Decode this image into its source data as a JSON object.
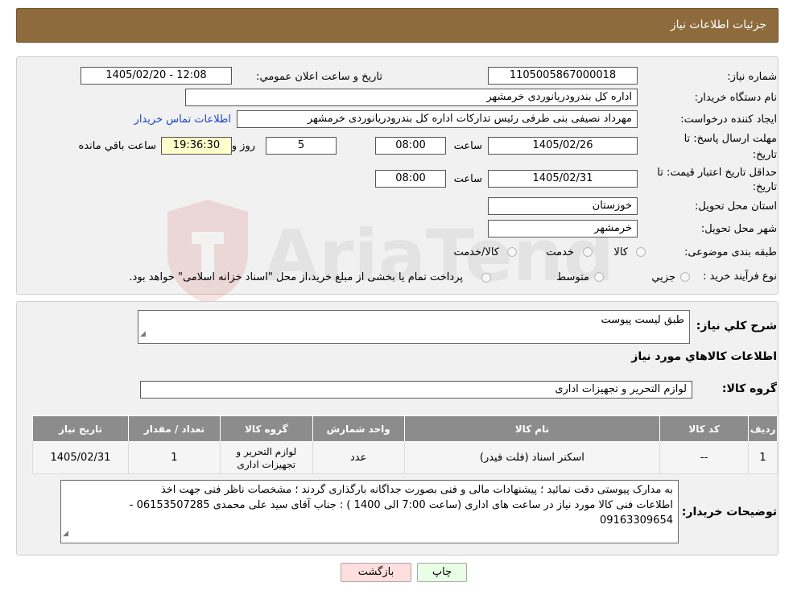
{
  "header": {
    "title": "جزئیات اطلاعات نیاز"
  },
  "fields": {
    "need_number_label": "شماره نیاز:",
    "need_number_value": "1105005867000018",
    "announce_label": "تاریخ و ساعت اعلان عمومي:",
    "announce_value": "1405/02/20 - 12:08",
    "buyer_label": "نام دستگاه خريدار:",
    "buyer_value": "اداره کل بندرودریانوردی خرمشهر",
    "creator_label": "ايجاد کننده درخواست:",
    "creator_value": "مهرداد  نصیفی بنی طرفی رئیس تدارکات اداره کل بندرودریانوردی خرمشهر",
    "contact_link": "اطلاعات تماس خريدار",
    "deadline_label_1": "مهلت ارسال پاسخ: تا",
    "deadline_label_2": "تاريخ:",
    "deadline_date": "1405/02/26",
    "time_label": "ساعت",
    "deadline_time": "08:00",
    "days_value": "5",
    "days_label": "روز و",
    "remaining_value": "19:36:30",
    "remaining_label": "ساعت باقي مانده",
    "validity_label_1": "حداقل تاريخ اعتبار قيمت: تا",
    "validity_label_2": "تاريخ:",
    "validity_date": "1405/02/31",
    "validity_time": "08:00",
    "province_label": "استان محل تحويل:",
    "province_value": "خوزستان",
    "city_label": "شهر محل تحويل:",
    "city_value": "خرمشهر",
    "category_label": "طبقه بندی موضوعی:",
    "category_options": [
      "کالا",
      "خدمت",
      "کالا/خدمت"
    ],
    "process_label": "نوع فرآيند خريد :",
    "process_options": [
      "جزيي",
      "متوسط"
    ],
    "process_note": "پرداخت تمام یا بخشی از مبلغ خرید،از محل \"اسناد خزانه اسلامی\" خواهد بود."
  },
  "summary": {
    "label": "شرح کلي نياز:",
    "value": "طبق لیست پیوست",
    "goods_info_title": "اطلاعات کالاهاي مورد نياز",
    "group_label": "گروه کالا:",
    "group_value": "لوازم التحریر و تجهیزات اداری"
  },
  "table": {
    "headers": [
      "رديف",
      "کد کالا",
      "نام کالا",
      "واحد شمارش",
      "گروه کالا",
      "تعداد / مقدار",
      "تاريخ نياز"
    ],
    "rows": [
      [
        "1",
        "--",
        "اسکنر اسناد (فلت فیدر)",
        "عدد",
        "لوازم التحریر و تجهیزات اداری",
        "1",
        "1405/02/31"
      ]
    ]
  },
  "notes": {
    "label": "توضيحات خريدار:",
    "line1": "به مدارک پیوستی دقت نمائید ؛ پیشنهادات مالی و فنی بصورت جداگانه بارگذاری گردند ؛ مشخصات ناظر فنی جهت اخذ",
    "line2": "اطلاعات فنی کالا مورد نیاز در ساعت های اداری (ساعت 7:00 الی 1400 ) : جناب آقای سید علی محمدی 06153507285 -",
    "line3": "09163309654"
  },
  "buttons": {
    "print": "چاپ",
    "back": "بازگشت"
  },
  "watermark": {
    "text": "AriaTender.neT"
  },
  "colors": {
    "header": "#8d6b3c",
    "table_header": "#8c8c8c",
    "print_btn": "#e9ffe5",
    "back_btn": "#ffdede"
  }
}
